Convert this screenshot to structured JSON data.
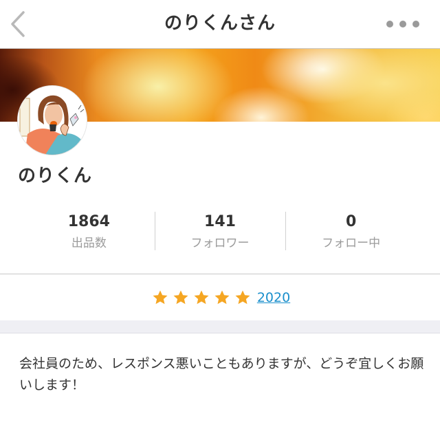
{
  "nav": {
    "title": "のりくんさん",
    "back_icon": "chevron-left-icon",
    "more_icon": "more-horizontal-icon"
  },
  "profile": {
    "username": "のりくん",
    "avatar": "illustrated-avatar"
  },
  "stats": [
    {
      "value": "1864",
      "label": "出品数"
    },
    {
      "value": "141",
      "label": "フォロワー"
    },
    {
      "value": "0",
      "label": "フォロー中"
    }
  ],
  "rating": {
    "stars": 5,
    "count": "2020",
    "star_color": "#f5a623",
    "link_color": "#1a8fcc"
  },
  "bio": {
    "text": "会社員のため、レスポンス悪いこともありますが、どうぞ宜しくお願いします！"
  }
}
